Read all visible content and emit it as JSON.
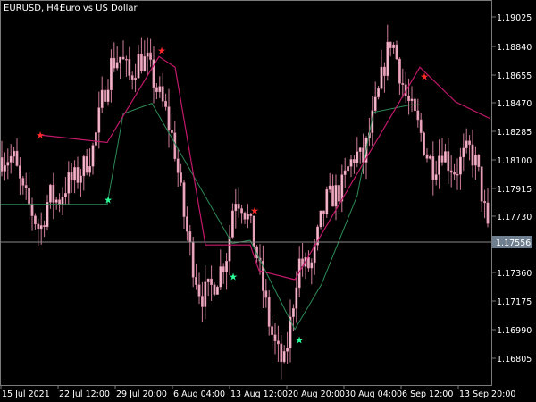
{
  "header": {
    "symbol": "EURUSD, H4:",
    "description": "Euro vs US Dollar"
  },
  "colors": {
    "background": "#000000",
    "frame": "#7a7a7a",
    "candle": "#f4b8cc",
    "candle_outline": "#d07f9a",
    "upper_line": "#c2186b",
    "lower_line": "#2e8b57",
    "star_sell": "#ff2a2a",
    "star_buy": "#2bff9a",
    "price_line": "#8a8a8a",
    "price_label_bg": "#6f7f8f",
    "text": "#ffffff"
  },
  "price_axis": {
    "labels": [
      "1.19025",
      "1.18840",
      "1.18655",
      "1.18470",
      "1.18285",
      "1.18100",
      "1.17915",
      "1.17730",
      "1.17360",
      "1.17175",
      "1.16990",
      "1.16805"
    ],
    "current_price": "1.17556"
  },
  "time_axis": {
    "labels": [
      "15 Jul 2021",
      "22 Jul 12:00",
      "29 Jul 20:00",
      "6 Aug 04:00",
      "13 Aug 12:00",
      "20 Aug 20:00",
      "30 Aug 04:00",
      "6 Sep 12:00",
      "13 Sep 20:00"
    ]
  },
  "chart_data": {
    "type": "candlestick",
    "instrument": "EURUSD",
    "timeframe": "H4",
    "ylim": [
      1.1667,
      1.1916
    ],
    "close_path": [
      [
        15,
        1.1815
      ],
      [
        25,
        1.1792
      ],
      [
        35,
        1.178
      ],
      [
        45,
        1.1766
      ],
      [
        55,
        1.179
      ],
      [
        65,
        1.1786
      ],
      [
        75,
        1.1798
      ],
      [
        85,
        1.1801
      ],
      [
        95,
        1.181
      ],
      [
        105,
        1.1822
      ],
      [
        115,
        1.1855
      ],
      [
        125,
        1.1878
      ],
      [
        135,
        1.1882
      ],
      [
        145,
        1.1868
      ],
      [
        155,
        1.188
      ],
      [
        165,
        1.1878
      ],
      [
        175,
        1.1861
      ],
      [
        185,
        1.1846
      ],
      [
        195,
        1.1823
      ],
      [
        205,
        1.178
      ],
      [
        215,
        1.1747
      ],
      [
        225,
        1.1723
      ],
      [
        235,
        1.1727
      ],
      [
        245,
        1.1738
      ],
      [
        255,
        1.1753
      ],
      [
        262,
        1.179
      ],
      [
        270,
        1.1786
      ],
      [
        278,
        1.1774
      ],
      [
        286,
        1.1755
      ],
      [
        294,
        1.1729
      ],
      [
        302,
        1.1703
      ],
      [
        310,
        1.1686
      ],
      [
        318,
        1.1677
      ],
      [
        326,
        1.1709
      ],
      [
        334,
        1.1746
      ],
      [
        342,
        1.1742
      ],
      [
        350,
        1.1744
      ],
      [
        358,
        1.177
      ],
      [
        366,
        1.1787
      ],
      [
        374,
        1.179
      ],
      [
        382,
        1.1794
      ],
      [
        390,
        1.1808
      ],
      [
        398,
        1.1818
      ],
      [
        406,
        1.1812
      ],
      [
        414,
        1.1833
      ],
      [
        422,
        1.1852
      ],
      [
        430,
        1.1876
      ],
      [
        438,
        1.1895
      ],
      [
        446,
        1.1876
      ],
      [
        454,
        1.1856
      ],
      [
        462,
        1.1844
      ],
      [
        470,
        1.1833
      ],
      [
        478,
        1.1817
      ],
      [
        486,
        1.1808
      ],
      [
        494,
        1.1822
      ],
      [
        502,
        1.1812
      ],
      [
        510,
        1.1806
      ],
      [
        518,
        1.1815
      ],
      [
        526,
        1.182
      ],
      [
        534,
        1.1809
      ],
      [
        542,
        1.1782
      ],
      [
        548,
        1.1756
      ]
    ],
    "upper_line": [
      [
        45,
        1.183
      ],
      [
        120,
        1.1825
      ],
      [
        178,
        1.1882
      ],
      [
        196,
        1.1875
      ],
      [
        230,
        1.1757
      ],
      [
        280,
        1.1757
      ],
      [
        290,
        1.174
      ],
      [
        330,
        1.1734
      ],
      [
        470,
        1.1875
      ],
      [
        510,
        1.1852
      ],
      [
        548,
        1.1841
      ]
    ],
    "lower_line": [
      [
        0,
        1.1784
      ],
      [
        30,
        1.1784
      ],
      [
        120,
        1.1784
      ],
      [
        138,
        1.1844
      ],
      [
        170,
        1.1851
      ],
      [
        260,
        1.1758
      ],
      [
        280,
        1.176
      ],
      [
        330,
        1.1701
      ],
      [
        360,
        1.1731
      ],
      [
        400,
        1.179
      ],
      [
        418,
        1.1845
      ],
      [
        460,
        1.185
      ],
      [
        470,
        1.185
      ]
    ],
    "sell_signals": [
      [
        45,
        1.183
      ],
      [
        181,
        1.1886
      ],
      [
        285,
        1.178
      ],
      [
        475,
        1.1869
      ]
    ],
    "buy_signals": [
      [
        121,
        1.1787
      ],
      [
        261,
        1.1736
      ],
      [
        335,
        1.1694
      ]
    ]
  }
}
